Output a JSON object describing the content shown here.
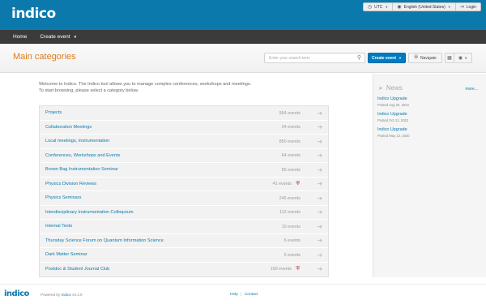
{
  "header": {
    "logo_text": "indico",
    "timezone": "UTC",
    "language": "English (United States)",
    "login": "Login"
  },
  "nav": {
    "home": "Home",
    "create_event": "Create event"
  },
  "page": {
    "title": "Main categories",
    "search_placeholder": "Enter your search term",
    "create_event_button": "Create event",
    "navigate_button": "Navigate"
  },
  "intro": {
    "line1": "Welcome to Indico. The Indico tool allows you to manage complex conferences, workshops and meetings.",
    "line2": "To start browsing, please select a category below."
  },
  "categories": [
    {
      "name": "Projects",
      "count": "964 events",
      "protected": false
    },
    {
      "name": "Collaboration Meetings",
      "count": "24 events",
      "protected": false
    },
    {
      "name": "Local meetings, Instrumentation",
      "count": "850 events",
      "protected": false
    },
    {
      "name": "Conferences, Workshops and Events",
      "count": "64 events",
      "protected": false
    },
    {
      "name": "Brown Bag Instrumentation Seminar",
      "count": "56 events",
      "protected": false
    },
    {
      "name": "Physics Division Reviews",
      "count": "41 events",
      "protected": true
    },
    {
      "name": "Physics Seminars",
      "count": "245 events",
      "protected": false
    },
    {
      "name": "Interdisciplinary Instrumentation Colloquium",
      "count": "112 events",
      "protected": false
    },
    {
      "name": "Internal Tests",
      "count": "10 events",
      "protected": false
    },
    {
      "name": "Thursday Science Forum on Quantum Information Science",
      "count": "6 events",
      "protected": false
    },
    {
      "name": "Dark Matter Seminar",
      "count": "5 events",
      "protected": false
    },
    {
      "name": "Postdoc & Student Journal Club",
      "count": "100 events",
      "protected": true
    }
  ],
  "news": {
    "heading": "News",
    "more": "more...",
    "items": [
      {
        "title": "Indico Upgrade",
        "date": "Posted Aug 20, 2024"
      },
      {
        "title": "Indico Upgrade",
        "date": "Posted Oct 12, 2022"
      },
      {
        "title": "Indico Upgrade",
        "date": "Posted May 13, 2020"
      }
    ]
  },
  "footer": {
    "logo_text": "indico",
    "powered_by": "Powered by",
    "powered_link": "Indico",
    "version": "v3.3.6",
    "help": "Help",
    "separator": "|",
    "contact": "Contact"
  },
  "colors": {
    "header_bg": "#0b79ac",
    "nav_bg": "#3b3b3b",
    "title_orange": "#e07b1a",
    "link_blue": "#0b79ac",
    "primary_button": "#007cc1",
    "protected_icon": "#b02020"
  },
  "icons": {
    "timezone": "clock-icon",
    "language": "globe-icon",
    "login": "login-icon",
    "search": "search-icon",
    "navigate": "compass-icon",
    "calendar": "calendar-icon",
    "view": "eye-icon",
    "category_arrow": "arrow-right-icon",
    "protected": "shield-icon",
    "news": "megaphone-icon"
  }
}
